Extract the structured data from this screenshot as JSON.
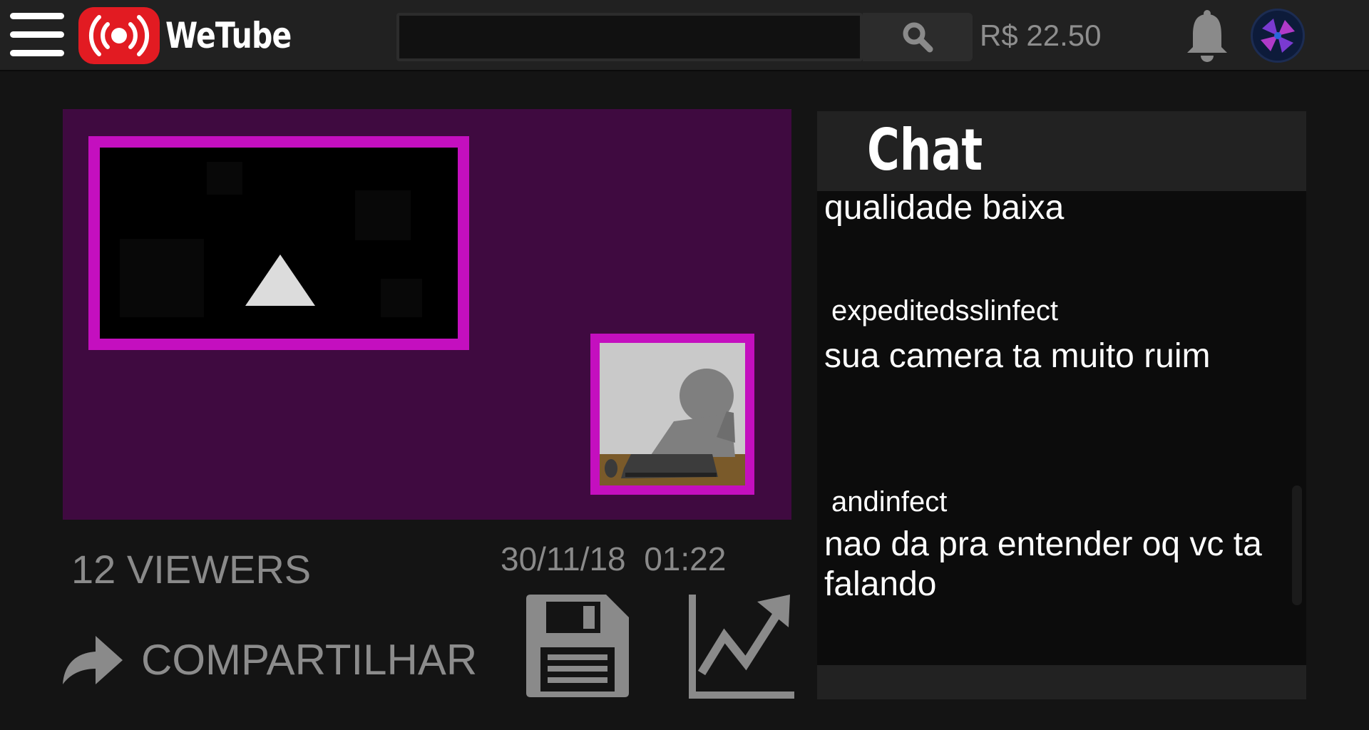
{
  "header": {
    "logo_text": "WeTube",
    "search": {
      "value": "",
      "placeholder": ""
    },
    "balance": "R$ 22.50",
    "icons": {
      "menu": "hamburger-menu-icon",
      "logo": "live-broadcast-icon",
      "search": "search-icon",
      "notifications": "bell-icon",
      "avatar": "avatar"
    }
  },
  "stream": {
    "viewers": "12 VIEWERS",
    "date": "30/11/18",
    "time": "01:22",
    "share_label": "COMPARTILHAR",
    "colors": {
      "background": "#3f0a40",
      "frame": "#c40fbf"
    }
  },
  "chat": {
    "title": "Chat",
    "messages": [
      {
        "user": "",
        "text": "qualidade baixa"
      },
      {
        "user": "expeditedsslinfect",
        "text": "sua camera ta muito ruim"
      },
      {
        "user": "andinfect",
        "text": "nao da pra entender oq vc ta falando"
      }
    ]
  }
}
